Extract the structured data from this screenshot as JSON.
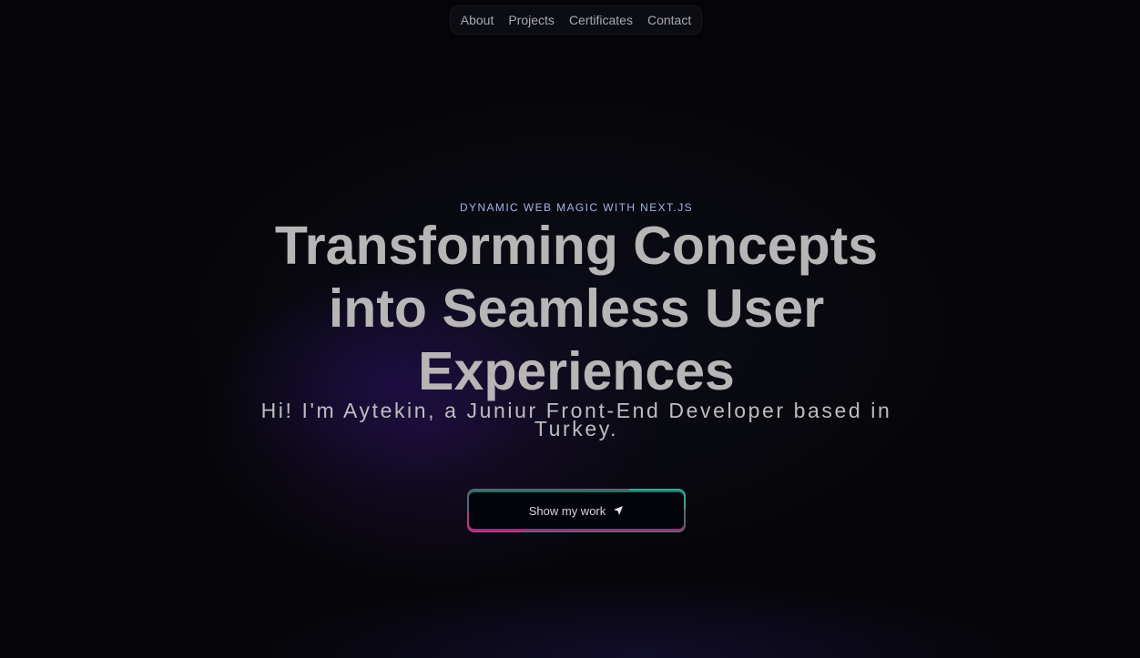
{
  "nav": {
    "items": [
      {
        "label": "About"
      },
      {
        "label": "Projects"
      },
      {
        "label": "Certificates"
      },
      {
        "label": "Contact"
      }
    ]
  },
  "hero": {
    "eyebrow": "DYNAMIC WEB MAGIC WITH NEXT.JS",
    "headline": "Transforming Concepts into Seamless User Experiences",
    "intro": "Hi! I'm Aytekin, a Juniur Front-End Developer based in Turkey.",
    "cta_label": "Show my work",
    "cta_icon": "send-icon"
  },
  "colors": {
    "background": "#050507",
    "eyebrow": "#a5b4e8",
    "headline": "#b7b5b5",
    "accent_green": "#3fa58f",
    "accent_pink": "#b03a89"
  }
}
